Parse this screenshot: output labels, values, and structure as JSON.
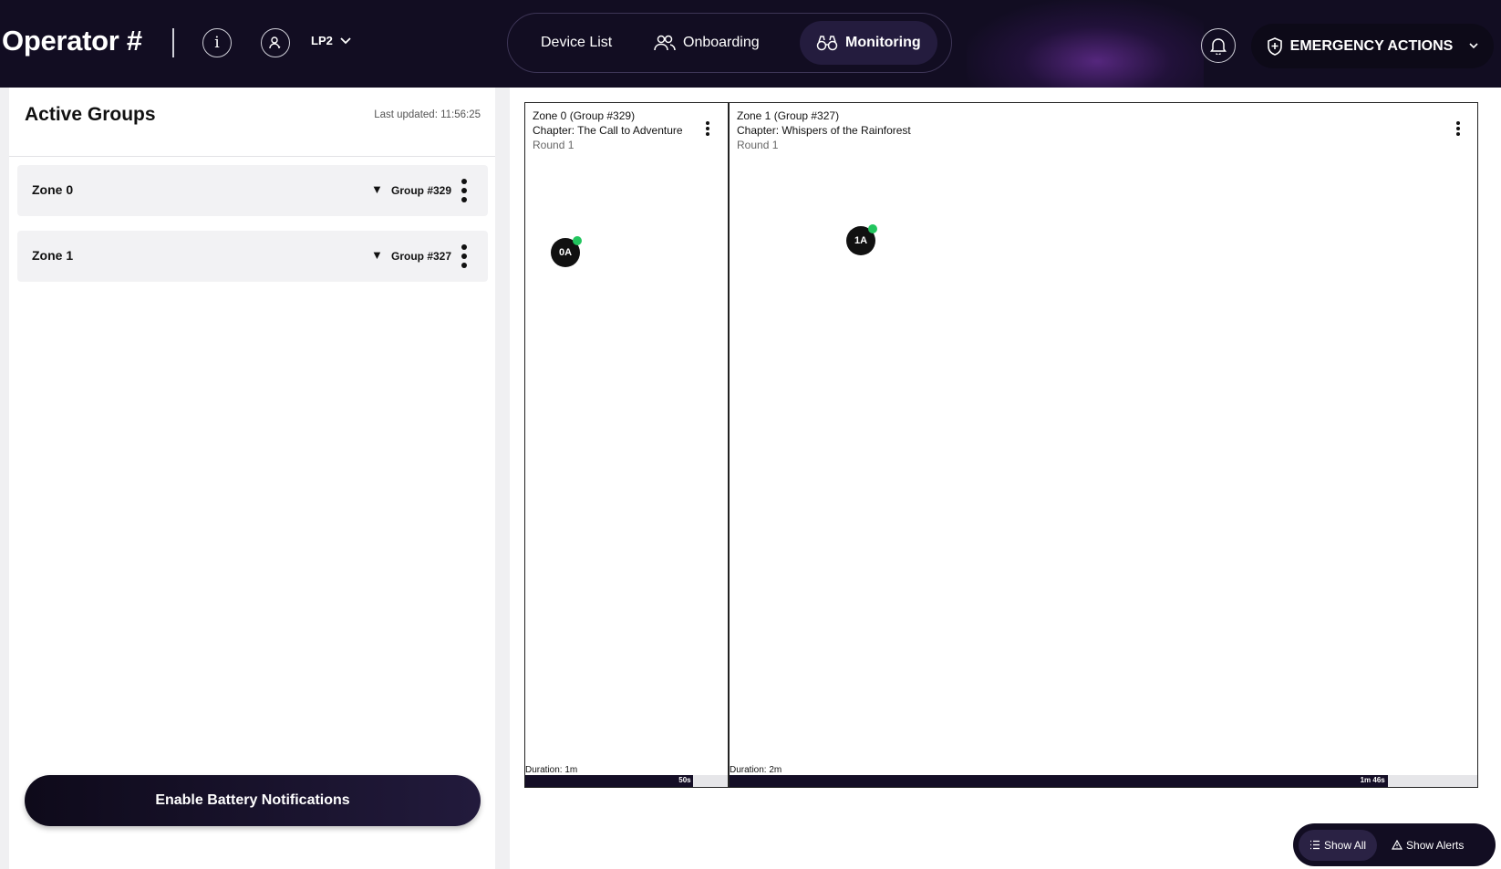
{
  "header": {
    "brand": "Operator #",
    "project_select": "LP2",
    "nav": [
      {
        "label": "Device List",
        "icon": "none"
      },
      {
        "label": "Onboarding",
        "icon": "users-icon"
      },
      {
        "label": "Monitoring",
        "icon": "binoculars-icon",
        "active": true
      }
    ],
    "emergency_label": "EMERGENCY ACTIONS"
  },
  "sidebar": {
    "title": "Active Groups",
    "last_updated": "Last updated: 11:56:25",
    "groups": [
      {
        "zone": "Zone 0",
        "group": "Group #329"
      },
      {
        "zone": "Zone 1",
        "group": "Group #327"
      }
    ],
    "battery_button": "Enable Battery Notifications"
  },
  "zones": [
    {
      "title": "Zone 0 (Group #329)",
      "chapter": "Chapter: The Call to Adventure",
      "round": "Round 1",
      "device": "0A",
      "device_status": "online",
      "duration": "Duration: 1m",
      "elapsed": "50s",
      "progress": 0.83
    },
    {
      "title": "Zone 1 (Group #327)",
      "chapter": "Chapter: Whispers of the Rainforest",
      "round": "Round 1",
      "device": "1A",
      "device_status": "online",
      "duration": "Duration: 2m",
      "elapsed": "1m 46s",
      "progress": 0.88
    }
  ],
  "view_toggle": {
    "show_all": "Show All",
    "show_alerts": "Show Alerts"
  },
  "colors": {
    "header_bg": "#120d22",
    "accent": "#22c55e",
    "progress": "#140e26"
  }
}
